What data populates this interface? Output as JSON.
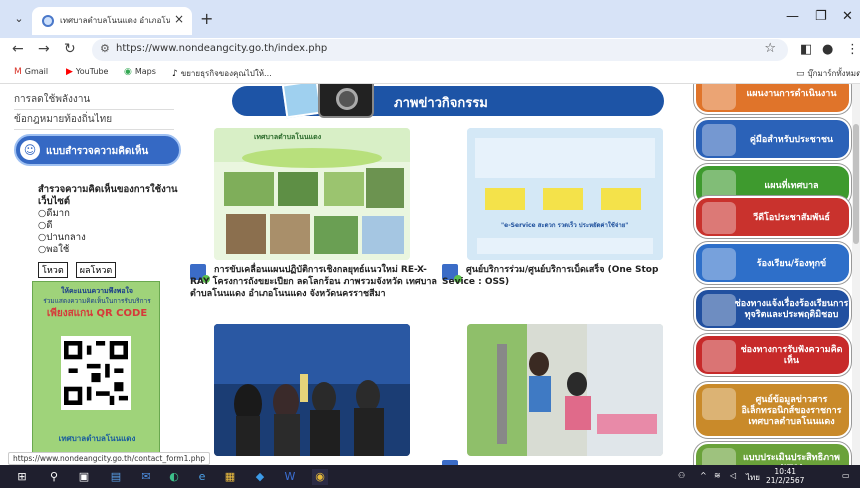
{
  "browser": {
    "tab_title": "เทศบาลตำบลโนนแดง อำเภอโนนแดง",
    "url": "https://www.nondeangcity.go.th/index.php",
    "bookmarks": [
      {
        "label": "Gmail",
        "icon": "gmail-icon"
      },
      {
        "label": "YouTube",
        "icon": "youtube-icon"
      },
      {
        "label": "Maps",
        "icon": "maps-icon"
      },
      {
        "label": "ขยายธุรกิจของคุณไปให้...",
        "icon": "tiktok-icon"
      }
    ],
    "bookmarks_folder": "บุ๊กมาร์กทั้งหมด",
    "status_url": "https://www.nondeangcity.go.th/contact_form1.php"
  },
  "left": {
    "links": [
      "การลดใช้พลังงาน",
      "ข้อกฎหมายท้องถิ่นไทย"
    ],
    "survey_banner": "แบบสำรวจความคิดเห็น",
    "poll": {
      "question": "สำรวจความคิดเห็นของการใช้งานเว็บไซต์",
      "options": [
        "ดีมาก",
        "ดี",
        "ปานกลาง",
        "พอใช้"
      ],
      "vote_label": "โหวต",
      "result_label": "ผลโหวต"
    },
    "qr_card": {
      "line1": "ให้คะแนนความพึงพอใจ",
      "line2": "ร่วมแสดงความคิดเห็นในการรับบริการ",
      "line3": "เพียงสแกน QR CODE",
      "footer": "เทศบาลตำบลโนนแดง"
    }
  },
  "main": {
    "banner_title": "ภาพข่าวกิจกรรม",
    "news": [
      {
        "caption": "การขับเคลื่อนแผนปฏิบัติการเชิงกลยุทธ์แนวใหม่ RE-X-RAY โครงการถังขยะเปียก ลดโลกร้อน ภาพรวมจังหวัด เทศบาลตำบลโนนแดง อำเภอโนนแดง จังหวัดนครราชสีมา",
        "thumb_text": "เทศบาลตำบลโนนแดง"
      },
      {
        "caption": "ศูนย์บริการร่วม/ศูนย์บริการเบ็ดเสร็จ (One Stop Sevice : OSS)",
        "thumb_text": "\"e-Service สะดวก รวดเร็ว ประหยัดค่าใช้จ่าย\""
      },
      {
        "caption": "",
        "thumb_text": ""
      },
      {
        "caption": "",
        "thumb_text": ""
      }
    ]
  },
  "right": {
    "buttons": [
      {
        "label": "แผนงานการดำเนินงาน",
        "color": "#e0742a"
      },
      {
        "label": "คู่มือสำหรับประชาชน",
        "color": "#2b62b8"
      },
      {
        "label": "แผนที่เทศบาล",
        "color": "#3e9a2e"
      },
      {
        "label": "วีดีโอประชาสัมพันธ์",
        "color": "#c9322d"
      },
      {
        "label": "ร้องเรียน/ร้องทุกข์",
        "color": "#2e6fc9"
      },
      {
        "label": "ช่องทางแจ้งเรื่องร้องเรียนการทุจริตและประพฤติมิชอบ",
        "color": "#2150a0"
      },
      {
        "label": "ช่องทางการรับฟังความคิดเห็น",
        "color": "#c72a2a"
      },
      {
        "label": "ศูนย์ข้อมูลข่าวสาร อิเล็กทรอนิกส์ของราชการ เทศบาลตำบลโนนแดง",
        "color": "#c98a2a"
      },
      {
        "label": "แบบประเมินประสิทธิภาพ (ITA)",
        "color": "#6aa23a"
      }
    ]
  },
  "taskbar": {
    "time": "10:41",
    "date": "21/2/2567",
    "lang": "ไทย"
  }
}
